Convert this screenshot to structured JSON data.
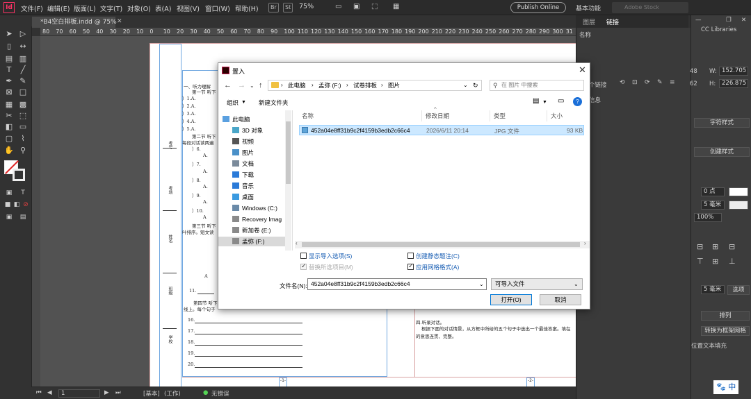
{
  "menubar": {
    "logo": "Id",
    "items": [
      "文件(F)",
      "编辑(E)",
      "版面(L)",
      "文字(T)",
      "对象(O)",
      "表(A)",
      "视图(V)",
      "窗口(W)",
      "帮助(H)"
    ],
    "br": "Br",
    "st": "St",
    "zoom": "75%",
    "publish": "Publish Online",
    "workspace": "基本功能",
    "search_placeholder": "Adobe Stock"
  },
  "document": {
    "tab": "*B4空白排板.indd @ 75%",
    "ruler_numbers": [
      "80",
      "70",
      "60",
      "50",
      "40",
      "30",
      "20",
      "10",
      "0",
      "10",
      "20",
      "30",
      "40",
      "50",
      "60",
      "70",
      "80",
      "90",
      "100",
      "110",
      "120",
      "130",
      "140",
      "150",
      "160",
      "170",
      "180",
      "190",
      "200",
      "210",
      "220",
      "230",
      "240",
      "250",
      "260",
      "270",
      "280",
      "290",
      "300",
      "31"
    ],
    "lines": [
      "一、听力理解",
      "第一节 听下",
      "）1.A.",
      "）2.A.",
      "）3.A.",
      "）4.A.",
      "）5.A.",
      "第二节 听下",
      "每段对话读两遍",
      "）6.",
      "A.",
      "）7.",
      "A.",
      "）8.",
      "A.",
      "）9.",
      "A.",
      "）10.",
      "A",
      "第三节 听下",
      "叶排序。短文读",
      "A",
      "11.",
      "第四节 听下",
      "线上。每个句子",
      "16.",
      "17.",
      "18.",
      "19.",
      "20."
    ],
    "right_col": [
      "四.听录对话。",
      "根据下面的对话情景，从方框中所给的五个句子中选出一个最佳答案。填在",
      "的意思连贯、完整。"
    ],
    "side_labels": [
      "考号",
      "考场",
      "姓名",
      "班级",
      "学校"
    ],
    "page_marks": [
      "-1-",
      "-2-"
    ]
  },
  "statusbar": {
    "page": "1",
    "style": "[基本]",
    "mode": "(工作)",
    "errors": "无错误"
  },
  "panels": {
    "tabs": [
      "图层",
      "链接"
    ],
    "name_header": "名称",
    "cc_libraries": "CC Libraries",
    "links_count": "个链接",
    "info": "信息",
    "w_label": "W:",
    "w_value": "152.705",
    "h_label": "H:",
    "h_value": "226.875",
    "x_value": "48",
    "y_value": "62",
    "char_style": "字符样式",
    "create_style": "创建样式",
    "pt_value": "0 点",
    "mm_value": "5 毫米",
    "pct_value": "100%",
    "mm2_value": "5 毫米",
    "options": "选项",
    "arrange": "排列",
    "convert_frame": "转换为框架网格",
    "text_fill": "位置文本填充"
  },
  "dialog": {
    "title": "置入",
    "path": [
      "此电脑",
      "孟弥 (F:)",
      "试卷排板",
      "图片"
    ],
    "search_placeholder": "在 图片 中搜索",
    "organize": "组织",
    "new_folder": "新建文件夹",
    "nav": [
      "此电脑",
      "3D 对象",
      "视频",
      "图片",
      "文档",
      "下载",
      "音乐",
      "桌面",
      "Windows (C:)",
      "Recovery Imag",
      "新加卷 (E:)",
      "孟弥 (F:)"
    ],
    "columns": [
      "名称",
      "修改日期",
      "类型",
      "大小"
    ],
    "file": {
      "name": "452a04e8ff31b9c2f4159b3edb2c66c4",
      "date": "2026/6/11 20:14",
      "type": "JPG 文件",
      "size": "93 KB"
    },
    "options": [
      {
        "label": "显示导入选项(S)",
        "checked": false,
        "disabled": false
      },
      {
        "label": "创建静态题注(C)",
        "checked": false,
        "disabled": false
      },
      {
        "label": "替换所选项目(M)",
        "checked": true,
        "disabled": true
      },
      {
        "label": "应用网格格式(A)",
        "checked": true,
        "disabled": false
      }
    ],
    "filename_label": "文件名(N):",
    "filename_value": "452a04e8ff31b9c2f4159b3edb2c66c4",
    "filetype": "可导入文件",
    "open": "打开(O)",
    "cancel": "取消"
  },
  "ime": "中"
}
